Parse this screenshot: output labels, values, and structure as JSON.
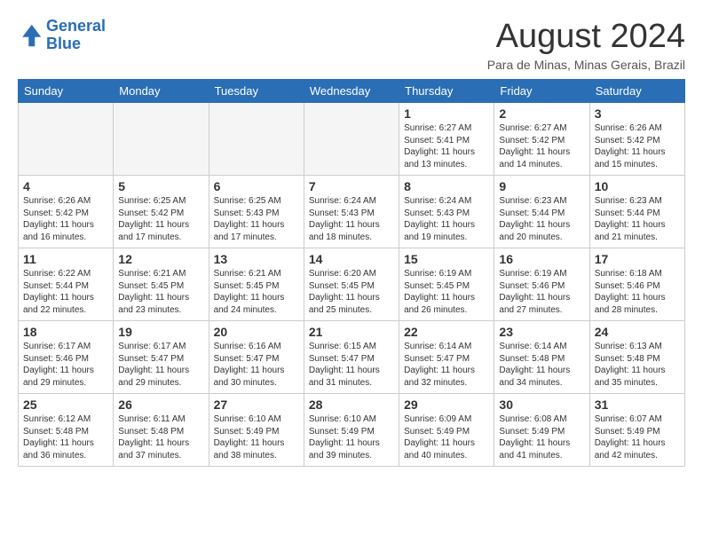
{
  "header": {
    "logo_line1": "General",
    "logo_line2": "Blue",
    "month_title": "August 2024",
    "location": "Para de Minas, Minas Gerais, Brazil"
  },
  "days_of_week": [
    "Sunday",
    "Monday",
    "Tuesday",
    "Wednesday",
    "Thursday",
    "Friday",
    "Saturday"
  ],
  "weeks": [
    [
      {
        "day": "",
        "empty": true
      },
      {
        "day": "",
        "empty": true
      },
      {
        "day": "",
        "empty": true
      },
      {
        "day": "",
        "empty": true
      },
      {
        "day": "1",
        "info": "Sunrise: 6:27 AM\nSunset: 5:41 PM\nDaylight: 11 hours\nand 13 minutes."
      },
      {
        "day": "2",
        "info": "Sunrise: 6:27 AM\nSunset: 5:42 PM\nDaylight: 11 hours\nand 14 minutes."
      },
      {
        "day": "3",
        "info": "Sunrise: 6:26 AM\nSunset: 5:42 PM\nDaylight: 11 hours\nand 15 minutes."
      }
    ],
    [
      {
        "day": "4",
        "info": "Sunrise: 6:26 AM\nSunset: 5:42 PM\nDaylight: 11 hours\nand 16 minutes."
      },
      {
        "day": "5",
        "info": "Sunrise: 6:25 AM\nSunset: 5:42 PM\nDaylight: 11 hours\nand 17 minutes."
      },
      {
        "day": "6",
        "info": "Sunrise: 6:25 AM\nSunset: 5:43 PM\nDaylight: 11 hours\nand 17 minutes."
      },
      {
        "day": "7",
        "info": "Sunrise: 6:24 AM\nSunset: 5:43 PM\nDaylight: 11 hours\nand 18 minutes."
      },
      {
        "day": "8",
        "info": "Sunrise: 6:24 AM\nSunset: 5:43 PM\nDaylight: 11 hours\nand 19 minutes."
      },
      {
        "day": "9",
        "info": "Sunrise: 6:23 AM\nSunset: 5:44 PM\nDaylight: 11 hours\nand 20 minutes."
      },
      {
        "day": "10",
        "info": "Sunrise: 6:23 AM\nSunset: 5:44 PM\nDaylight: 11 hours\nand 21 minutes."
      }
    ],
    [
      {
        "day": "11",
        "info": "Sunrise: 6:22 AM\nSunset: 5:44 PM\nDaylight: 11 hours\nand 22 minutes."
      },
      {
        "day": "12",
        "info": "Sunrise: 6:21 AM\nSunset: 5:45 PM\nDaylight: 11 hours\nand 23 minutes."
      },
      {
        "day": "13",
        "info": "Sunrise: 6:21 AM\nSunset: 5:45 PM\nDaylight: 11 hours\nand 24 minutes."
      },
      {
        "day": "14",
        "info": "Sunrise: 6:20 AM\nSunset: 5:45 PM\nDaylight: 11 hours\nand 25 minutes."
      },
      {
        "day": "15",
        "info": "Sunrise: 6:19 AM\nSunset: 5:45 PM\nDaylight: 11 hours\nand 26 minutes."
      },
      {
        "day": "16",
        "info": "Sunrise: 6:19 AM\nSunset: 5:46 PM\nDaylight: 11 hours\nand 27 minutes."
      },
      {
        "day": "17",
        "info": "Sunrise: 6:18 AM\nSunset: 5:46 PM\nDaylight: 11 hours\nand 28 minutes."
      }
    ],
    [
      {
        "day": "18",
        "info": "Sunrise: 6:17 AM\nSunset: 5:46 PM\nDaylight: 11 hours\nand 29 minutes."
      },
      {
        "day": "19",
        "info": "Sunrise: 6:17 AM\nSunset: 5:47 PM\nDaylight: 11 hours\nand 29 minutes."
      },
      {
        "day": "20",
        "info": "Sunrise: 6:16 AM\nSunset: 5:47 PM\nDaylight: 11 hours\nand 30 minutes."
      },
      {
        "day": "21",
        "info": "Sunrise: 6:15 AM\nSunset: 5:47 PM\nDaylight: 11 hours\nand 31 minutes."
      },
      {
        "day": "22",
        "info": "Sunrise: 6:14 AM\nSunset: 5:47 PM\nDaylight: 11 hours\nand 32 minutes."
      },
      {
        "day": "23",
        "info": "Sunrise: 6:14 AM\nSunset: 5:48 PM\nDaylight: 11 hours\nand 34 minutes."
      },
      {
        "day": "24",
        "info": "Sunrise: 6:13 AM\nSunset: 5:48 PM\nDaylight: 11 hours\nand 35 minutes."
      }
    ],
    [
      {
        "day": "25",
        "info": "Sunrise: 6:12 AM\nSunset: 5:48 PM\nDaylight: 11 hours\nand 36 minutes."
      },
      {
        "day": "26",
        "info": "Sunrise: 6:11 AM\nSunset: 5:48 PM\nDaylight: 11 hours\nand 37 minutes."
      },
      {
        "day": "27",
        "info": "Sunrise: 6:10 AM\nSunset: 5:49 PM\nDaylight: 11 hours\nand 38 minutes."
      },
      {
        "day": "28",
        "info": "Sunrise: 6:10 AM\nSunset: 5:49 PM\nDaylight: 11 hours\nand 39 minutes."
      },
      {
        "day": "29",
        "info": "Sunrise: 6:09 AM\nSunset: 5:49 PM\nDaylight: 11 hours\nand 40 minutes."
      },
      {
        "day": "30",
        "info": "Sunrise: 6:08 AM\nSunset: 5:49 PM\nDaylight: 11 hours\nand 41 minutes."
      },
      {
        "day": "31",
        "info": "Sunrise: 6:07 AM\nSunset: 5:49 PM\nDaylight: 11 hours\nand 42 minutes."
      }
    ]
  ]
}
